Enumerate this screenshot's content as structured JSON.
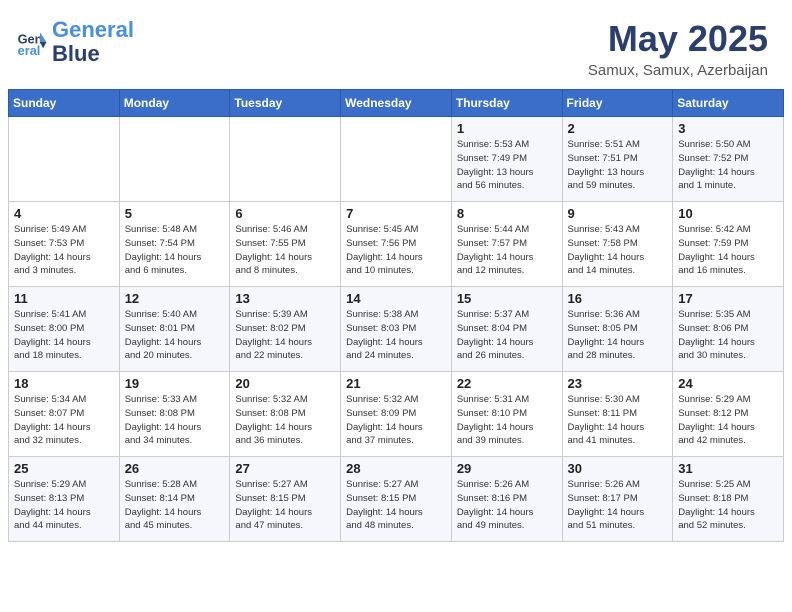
{
  "header": {
    "logo_line1": "General",
    "logo_line2": "Blue",
    "main_title": "May 2025",
    "subtitle": "Samux, Samux, Azerbaijan"
  },
  "days_of_week": [
    "Sunday",
    "Monday",
    "Tuesday",
    "Wednesday",
    "Thursday",
    "Friday",
    "Saturday"
  ],
  "weeks": [
    [
      {
        "day": "",
        "info": ""
      },
      {
        "day": "",
        "info": ""
      },
      {
        "day": "",
        "info": ""
      },
      {
        "day": "",
        "info": ""
      },
      {
        "day": "1",
        "info": "Sunrise: 5:53 AM\nSunset: 7:49 PM\nDaylight: 13 hours\nand 56 minutes."
      },
      {
        "day": "2",
        "info": "Sunrise: 5:51 AM\nSunset: 7:51 PM\nDaylight: 13 hours\nand 59 minutes."
      },
      {
        "day": "3",
        "info": "Sunrise: 5:50 AM\nSunset: 7:52 PM\nDaylight: 14 hours\nand 1 minute."
      }
    ],
    [
      {
        "day": "4",
        "info": "Sunrise: 5:49 AM\nSunset: 7:53 PM\nDaylight: 14 hours\nand 3 minutes."
      },
      {
        "day": "5",
        "info": "Sunrise: 5:48 AM\nSunset: 7:54 PM\nDaylight: 14 hours\nand 6 minutes."
      },
      {
        "day": "6",
        "info": "Sunrise: 5:46 AM\nSunset: 7:55 PM\nDaylight: 14 hours\nand 8 minutes."
      },
      {
        "day": "7",
        "info": "Sunrise: 5:45 AM\nSunset: 7:56 PM\nDaylight: 14 hours\nand 10 minutes."
      },
      {
        "day": "8",
        "info": "Sunrise: 5:44 AM\nSunset: 7:57 PM\nDaylight: 14 hours\nand 12 minutes."
      },
      {
        "day": "9",
        "info": "Sunrise: 5:43 AM\nSunset: 7:58 PM\nDaylight: 14 hours\nand 14 minutes."
      },
      {
        "day": "10",
        "info": "Sunrise: 5:42 AM\nSunset: 7:59 PM\nDaylight: 14 hours\nand 16 minutes."
      }
    ],
    [
      {
        "day": "11",
        "info": "Sunrise: 5:41 AM\nSunset: 8:00 PM\nDaylight: 14 hours\nand 18 minutes."
      },
      {
        "day": "12",
        "info": "Sunrise: 5:40 AM\nSunset: 8:01 PM\nDaylight: 14 hours\nand 20 minutes."
      },
      {
        "day": "13",
        "info": "Sunrise: 5:39 AM\nSunset: 8:02 PM\nDaylight: 14 hours\nand 22 minutes."
      },
      {
        "day": "14",
        "info": "Sunrise: 5:38 AM\nSunset: 8:03 PM\nDaylight: 14 hours\nand 24 minutes."
      },
      {
        "day": "15",
        "info": "Sunrise: 5:37 AM\nSunset: 8:04 PM\nDaylight: 14 hours\nand 26 minutes."
      },
      {
        "day": "16",
        "info": "Sunrise: 5:36 AM\nSunset: 8:05 PM\nDaylight: 14 hours\nand 28 minutes."
      },
      {
        "day": "17",
        "info": "Sunrise: 5:35 AM\nSunset: 8:06 PM\nDaylight: 14 hours\nand 30 minutes."
      }
    ],
    [
      {
        "day": "18",
        "info": "Sunrise: 5:34 AM\nSunset: 8:07 PM\nDaylight: 14 hours\nand 32 minutes."
      },
      {
        "day": "19",
        "info": "Sunrise: 5:33 AM\nSunset: 8:08 PM\nDaylight: 14 hours\nand 34 minutes."
      },
      {
        "day": "20",
        "info": "Sunrise: 5:32 AM\nSunset: 8:08 PM\nDaylight: 14 hours\nand 36 minutes."
      },
      {
        "day": "21",
        "info": "Sunrise: 5:32 AM\nSunset: 8:09 PM\nDaylight: 14 hours\nand 37 minutes."
      },
      {
        "day": "22",
        "info": "Sunrise: 5:31 AM\nSunset: 8:10 PM\nDaylight: 14 hours\nand 39 minutes."
      },
      {
        "day": "23",
        "info": "Sunrise: 5:30 AM\nSunset: 8:11 PM\nDaylight: 14 hours\nand 41 minutes."
      },
      {
        "day": "24",
        "info": "Sunrise: 5:29 AM\nSunset: 8:12 PM\nDaylight: 14 hours\nand 42 minutes."
      }
    ],
    [
      {
        "day": "25",
        "info": "Sunrise: 5:29 AM\nSunset: 8:13 PM\nDaylight: 14 hours\nand 44 minutes."
      },
      {
        "day": "26",
        "info": "Sunrise: 5:28 AM\nSunset: 8:14 PM\nDaylight: 14 hours\nand 45 minutes."
      },
      {
        "day": "27",
        "info": "Sunrise: 5:27 AM\nSunset: 8:15 PM\nDaylight: 14 hours\nand 47 minutes."
      },
      {
        "day": "28",
        "info": "Sunrise: 5:27 AM\nSunset: 8:15 PM\nDaylight: 14 hours\nand 48 minutes."
      },
      {
        "day": "29",
        "info": "Sunrise: 5:26 AM\nSunset: 8:16 PM\nDaylight: 14 hours\nand 49 minutes."
      },
      {
        "day": "30",
        "info": "Sunrise: 5:26 AM\nSunset: 8:17 PM\nDaylight: 14 hours\nand 51 minutes."
      },
      {
        "day": "31",
        "info": "Sunrise: 5:25 AM\nSunset: 8:18 PM\nDaylight: 14 hours\nand 52 minutes."
      }
    ]
  ]
}
